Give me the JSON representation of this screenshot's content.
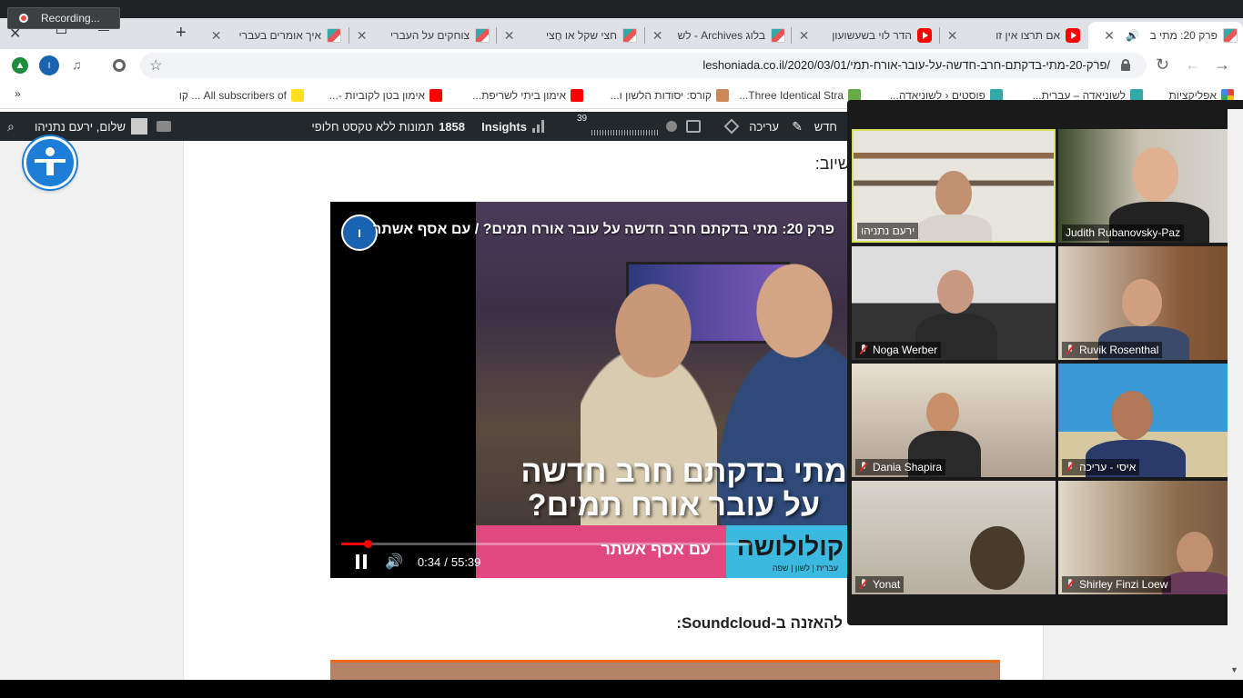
{
  "recording": {
    "label": "Recording..."
  },
  "tabs": [
    {
      "title": "פרק 20: מתי ב",
      "active": true
    },
    {
      "title": "אם תרצו אין זו"
    },
    {
      "title": "הדר לוי בשעשועון"
    },
    {
      "title": "בלוג Archives - לש"
    },
    {
      "title": "חצי שקל או חֲצי"
    },
    {
      "title": "צוחקים על העברי"
    },
    {
      "title": "איך אומרים בעברי"
    }
  ],
  "toolbar": {
    "url": "leshoniada.co.il/2020/03/01/פרק-20-מתי-בדקתם-חרב-חדשה-על-עובר-אורח-תמי/",
    "profile_initial": "ו"
  },
  "bookmarks": [
    {
      "label": "אפליקציות"
    },
    {
      "label": "לשוניאדה – עברית..."
    },
    {
      "label": "פוסטים ‹ לשוניאדה..."
    },
    {
      "label": "Three Identical Stra..."
    },
    {
      "label": "קורס: יסודות הלשון ו..."
    },
    {
      "label": "אימון ביתי לשריפת..."
    },
    {
      "label": "אימון בטן לקוביות -..."
    },
    {
      "label": "All subscribers of ... קו"
    }
  ],
  "adminbar": {
    "new": "חדש",
    "edit": "עריכה",
    "insights": "Insights",
    "images_count": "1858",
    "images_label": "תמונות ללא טקסט חלופי",
    "greeting": "שלום, ירעם נתניהו",
    "stat_badge": "39"
  },
  "video": {
    "title": "פרק 20: מתי בדקתם חרב חדשה על עובר אורח תמים? / עם אסף אשתר",
    "overlay_line1": "מתי בדקתם חרב חדשה",
    "overlay_line2": "על עובר אורח תמים?",
    "brand": "קולולושה",
    "brand_sub": "עברית | לשון | שפה",
    "with": "עם אסף אשתר",
    "logo": "ו",
    "time_current": "0:34",
    "time_sep": "/",
    "time_total": "55:39",
    "progress_fraction": 0.01
  },
  "page": {
    "text_top": "שיוב:",
    "text_bottom": "להאזנה ב-Soundcloud:"
  },
  "zoom": {
    "participants": [
      {
        "name": "ירעם נתניהו",
        "muted": false,
        "active": true
      },
      {
        "name": "Judith Rubanovsky-Paz",
        "muted": false
      },
      {
        "name": "Noga Werber",
        "muted": true
      },
      {
        "name": "Ruvik Rosenthal",
        "muted": true
      },
      {
        "name": "Dania Shapira",
        "muted": true
      },
      {
        "name": "איסי - עריכה",
        "muted": true
      },
      {
        "name": "Yonat",
        "muted": true
      },
      {
        "name": "Shirley Finzi Loew",
        "muted": true
      }
    ]
  },
  "colors": {
    "accent_blue": "#1e7dd6",
    "youtube_red": "#ff0000",
    "wp_bar": "#23282d",
    "zoom_active": "#d5e25a"
  }
}
